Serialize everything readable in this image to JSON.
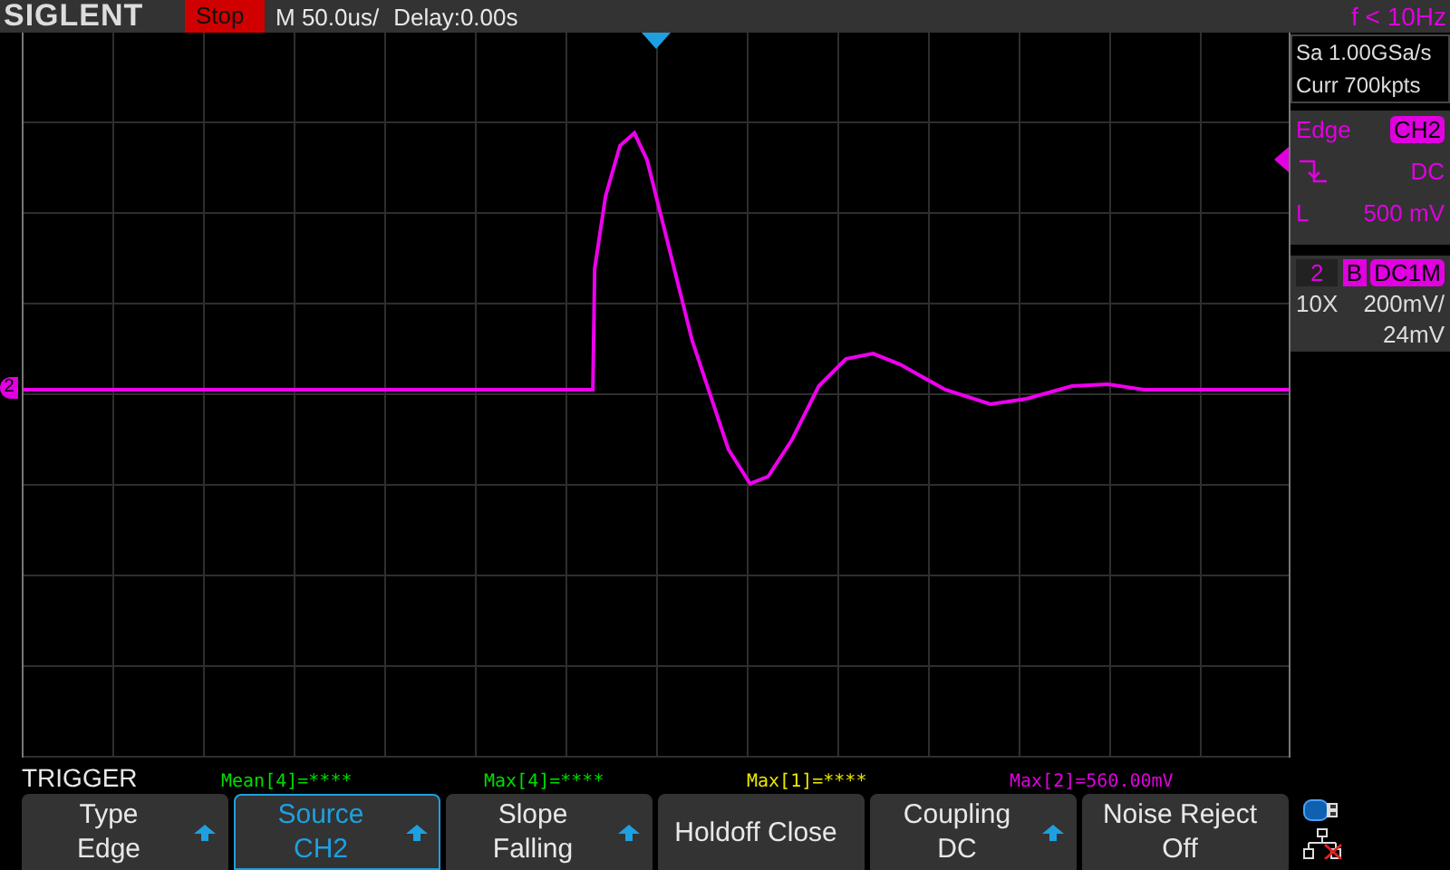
{
  "header": {
    "logo": "SIGLENT",
    "run_state": "Stop",
    "timebase": "M 50.0us/",
    "delay": "Delay:0.00s",
    "frequency": "f < 10Hz"
  },
  "acquisition": {
    "sample_rate": "Sa 1.00GSa/s",
    "memory": "Curr 700kpts"
  },
  "trigger_panel": {
    "type": "Edge",
    "source": "CH2",
    "coupling": "DC",
    "level_label": "L",
    "level": "500 mV"
  },
  "channel": {
    "number": "2",
    "bandwidth": "B",
    "coupling": "DC1M",
    "probe": "10X",
    "scale": "200mV/",
    "offset": "24mV"
  },
  "channel_marker": "2",
  "menu_title": "TRIGGER",
  "measurements": [
    {
      "text": "Mean[4]=****",
      "color": "#00dd00"
    },
    {
      "text": "Max[4]=****",
      "color": "#00dd00"
    },
    {
      "text": "Max[1]=****",
      "color": "#e8e800"
    },
    {
      "text": "Max[2]=560.00mV",
      "color": "#e000e0"
    }
  ],
  "softkeys": [
    {
      "kind": "two-line",
      "label": "Type",
      "value": "Edge",
      "has_arrow": true,
      "selected": false
    },
    {
      "kind": "two-line",
      "label": "Source",
      "value": "CH2",
      "has_arrow": true,
      "selected": true
    },
    {
      "kind": "two-line",
      "label": "Slope",
      "value": "Falling",
      "has_arrow": true,
      "selected": false
    },
    {
      "kind": "single",
      "label": "Holdoff Close",
      "has_arrow": false,
      "selected": false
    },
    {
      "kind": "two-line",
      "label": "Coupling",
      "value": "DC",
      "has_arrow": true,
      "selected": false
    },
    {
      "kind": "two-line",
      "label": "Noise Reject",
      "value": "Off",
      "has_arrow": false,
      "selected": false
    }
  ]
}
